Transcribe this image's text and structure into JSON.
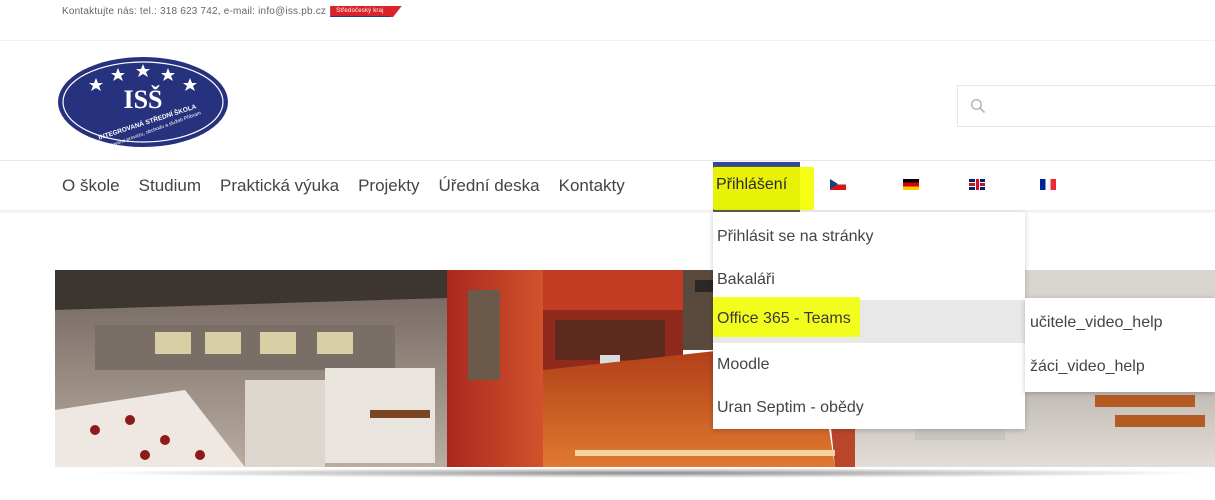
{
  "topbar": {
    "contact": "Kontaktujte nás: tel.: 318 623 742, e-mail: info@iss.pb.cz",
    "region_badge": "Středočeský kraj"
  },
  "logo": {
    "abbr": "ISŠ",
    "name": "INTEGROVANÁ STŘEDNÍ ŠKOLA",
    "subtitle": "hotelového provozu, obchodu a služeb Příbram"
  },
  "search": {
    "placeholder": ""
  },
  "nav": {
    "items": [
      {
        "label": "O škole"
      },
      {
        "label": "Studium"
      },
      {
        "label": "Praktická výuka"
      },
      {
        "label": "Projekty"
      },
      {
        "label": "Úřední deska"
      },
      {
        "label": "Kontakty"
      }
    ],
    "active": {
      "label": "Přihlášení"
    },
    "flags": [
      "czech-flag-icon",
      "german-flag-icon",
      "uk-flag-icon",
      "french-flag-icon"
    ]
  },
  "dropdown": {
    "items": [
      {
        "label": "Přihlásit se na stránky"
      },
      {
        "label": "Bakaláři"
      },
      {
        "label": "Office 365 - Teams"
      },
      {
        "label": "Moodle"
      },
      {
        "label": "Uran Septim - obědy"
      }
    ],
    "hovered_index": 2
  },
  "submenu": {
    "items": [
      {
        "label": "učitele_video_help"
      },
      {
        "label": "žáci_video_help"
      }
    ]
  },
  "colors": {
    "highlight": "#f4ff00",
    "active_tab": "#5b5b4f",
    "brand_blue": "#2f4a9c",
    "logo_navy": "#27327f"
  }
}
